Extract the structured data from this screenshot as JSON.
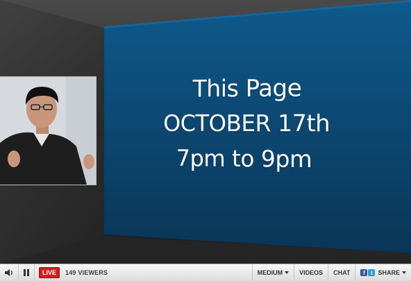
{
  "slide": {
    "line1": "This Page",
    "line2": "OCTOBER 17th",
    "line3": "7pm to 9pm",
    "colors": {
      "slide_top": "#0e5a8c",
      "slide_bottom": "#0a3557"
    }
  },
  "webcam": {
    "icon": "presenter-video-feed"
  },
  "controls": {
    "volume_icon": "speaker-icon",
    "pause_icon": "pause-icon",
    "live_label": "LIVE",
    "viewers_count": "149",
    "viewers_label": "VIEWERS",
    "quality_label": "MEDIUM",
    "videos_label": "VIDEOS",
    "chat_label": "CHAT",
    "share_label": "SHARE",
    "share_icons": [
      "facebook-icon",
      "twitter-icon"
    ],
    "colors": {
      "live": "#d41d1d",
      "bar": "#e8e8e8"
    }
  }
}
